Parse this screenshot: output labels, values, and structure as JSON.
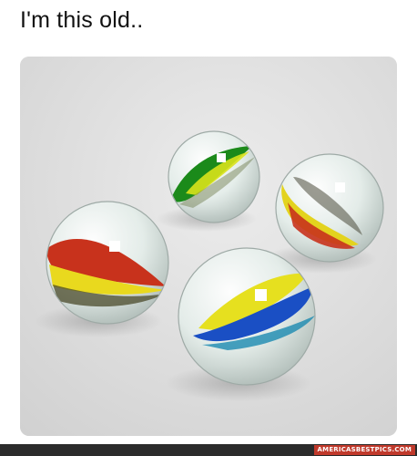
{
  "post": {
    "caption": "I'm this old.."
  },
  "image": {
    "subject": "four glass marbles with colored swirls",
    "background_color": "#dcdcdc",
    "marbles": [
      {
        "name": "green",
        "colors": [
          "#1b8a1a",
          "#d9e21b"
        ]
      },
      {
        "name": "red-yellow",
        "colors": [
          "#c8321c",
          "#e9d91e",
          "#4a4a2a"
        ]
      },
      {
        "name": "yellow-red",
        "colors": [
          "#e3d31e",
          "#c8321c",
          "#444444"
        ]
      },
      {
        "name": "blue-yellow",
        "colors": [
          "#1a4fc4",
          "#e6e01f",
          "#1a8ab0"
        ]
      }
    ]
  },
  "watermark": {
    "text": "AMERICASBESTPICS.COM"
  }
}
